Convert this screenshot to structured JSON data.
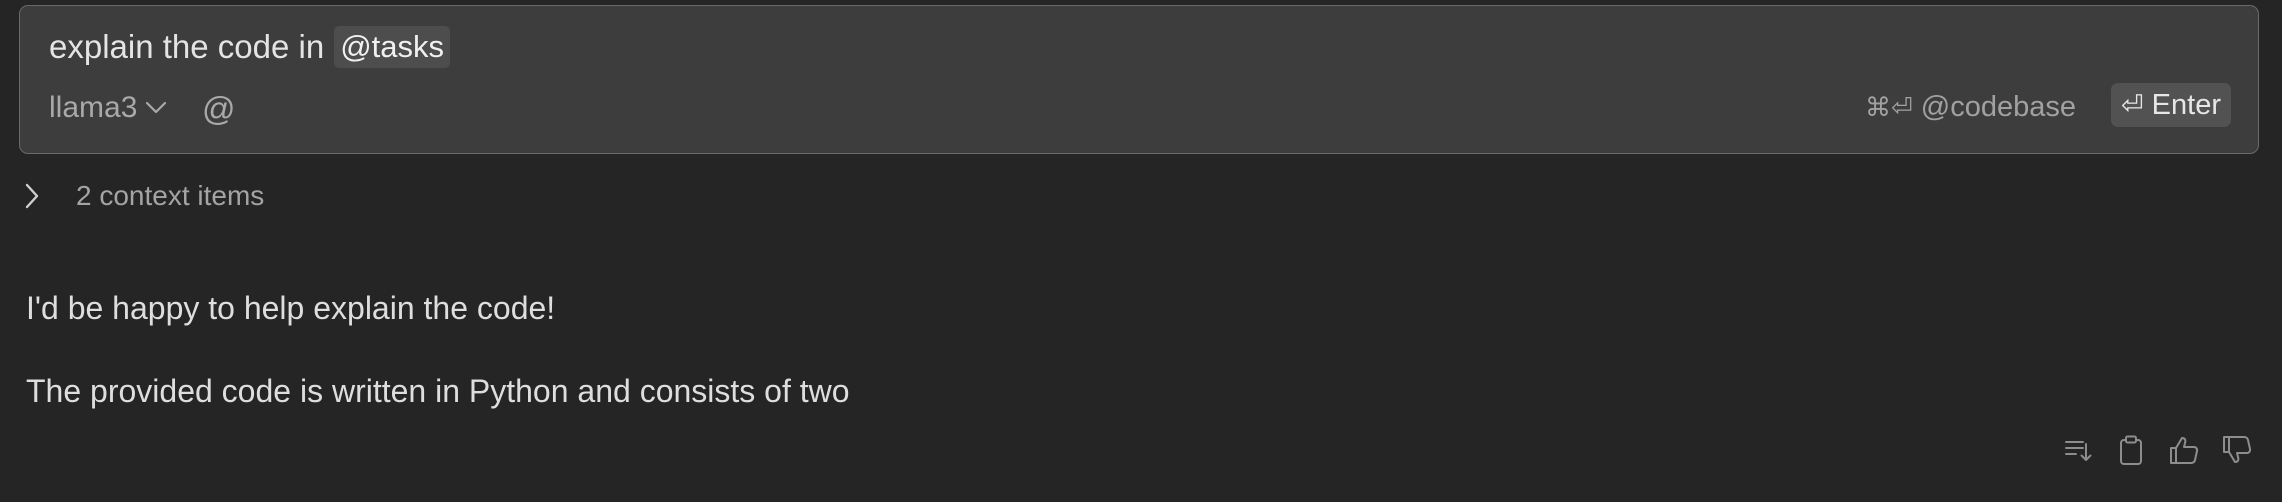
{
  "input": {
    "text": "explain the code in",
    "mention": "@tasks",
    "at_symbol": "@"
  },
  "model": {
    "selected": "llama3"
  },
  "shortcuts": {
    "codebase_keys": "⌘⏎",
    "codebase_label": "@codebase",
    "enter_glyph": "⏎",
    "enter_label": "Enter"
  },
  "context": {
    "label": "2 context items"
  },
  "response": {
    "line1": "I'd be happy to help explain the code!",
    "line2": "The provided code is written in Python and consists of two"
  },
  "actions": {
    "icons": [
      "continue-generation-icon",
      "copy-icon",
      "thumbs-up-icon",
      "thumbs-down-icon"
    ]
  },
  "colors": {
    "background": "#252525",
    "input_background": "#3d3d3d",
    "input_border": "#6a6a6a",
    "chip_background": "#4d4d4d",
    "enter_background": "#525252",
    "muted_text": "#a4a4a4",
    "icon_color": "#8d8d8d"
  }
}
